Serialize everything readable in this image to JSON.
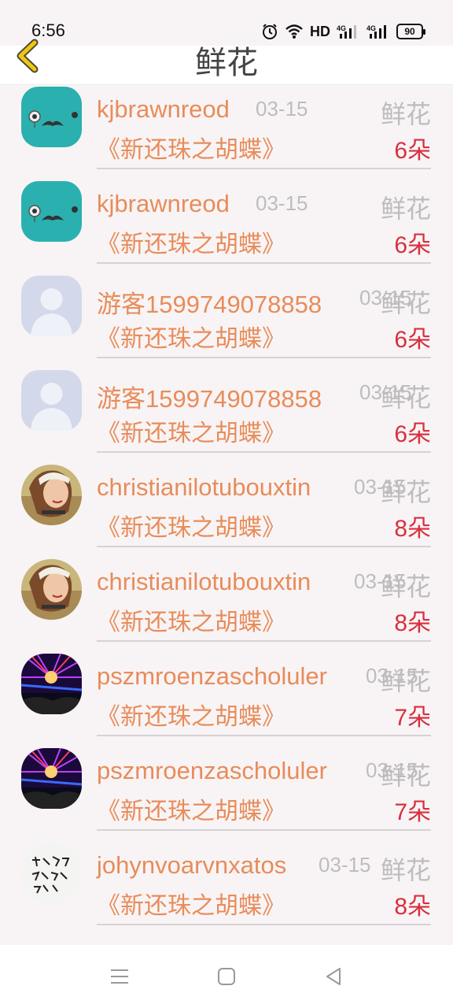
{
  "status": {
    "time": "6:56",
    "network": "HD",
    "signal1": "4G",
    "signal2": "4G",
    "battery": "90"
  },
  "header": {
    "title": "鲜花"
  },
  "rows": [
    {
      "username": "kjbrawnreod",
      "date": "03-15",
      "gift": "鲜花",
      "work": "《新还珠之胡蝶》",
      "count": "6朵",
      "avatar": "mustache-avatar"
    },
    {
      "username": "kjbrawnreod",
      "date": "03-15",
      "gift": "鲜花",
      "work": "《新还珠之胡蝶》",
      "count": "6朵",
      "avatar": "mustache-avatar"
    },
    {
      "username": "游客1599749078858",
      "date": "03-15",
      "gift": "鲜花",
      "work": "《新还珠之胡蝶》",
      "count": "6朵",
      "avatar": "default-avatar"
    },
    {
      "username": "游客1599749078858",
      "date": "03-15",
      "gift": "鲜花",
      "work": "《新还珠之胡蝶》",
      "count": "6朵",
      "avatar": "default-avatar"
    },
    {
      "username": "christianilotubouxtin",
      "date": "03-15",
      "gift": "鲜花",
      "work": "《新还珠之胡蝶》",
      "count": "8朵",
      "avatar": "girl-photo-avatar"
    },
    {
      "username": "christianilotubouxtin",
      "date": "03-15",
      "gift": "鲜花",
      "work": "《新还珠之胡蝶》",
      "count": "8朵",
      "avatar": "girl-photo-avatar"
    },
    {
      "username": "pszmroenzascholuler",
      "date": "03-15",
      "gift": "鲜花",
      "work": "《新还珠之胡蝶》",
      "count": "7朵",
      "avatar": "concert-avatar"
    },
    {
      "username": "pszmroenzascholuler",
      "date": "03-15",
      "gift": "鲜花",
      "work": "《新还珠之胡蝶》",
      "count": "7朵",
      "avatar": "concert-avatar"
    },
    {
      "username": "johynvoarvnxatos",
      "date": "03-15",
      "gift": "鲜花",
      "work": "《新还珠之胡蝶》",
      "count": "8朵",
      "avatar": "calligraphy-avatar"
    }
  ],
  "nav": {
    "menu": "menu-icon",
    "home": "home-icon",
    "back": "back-triangle-icon"
  }
}
